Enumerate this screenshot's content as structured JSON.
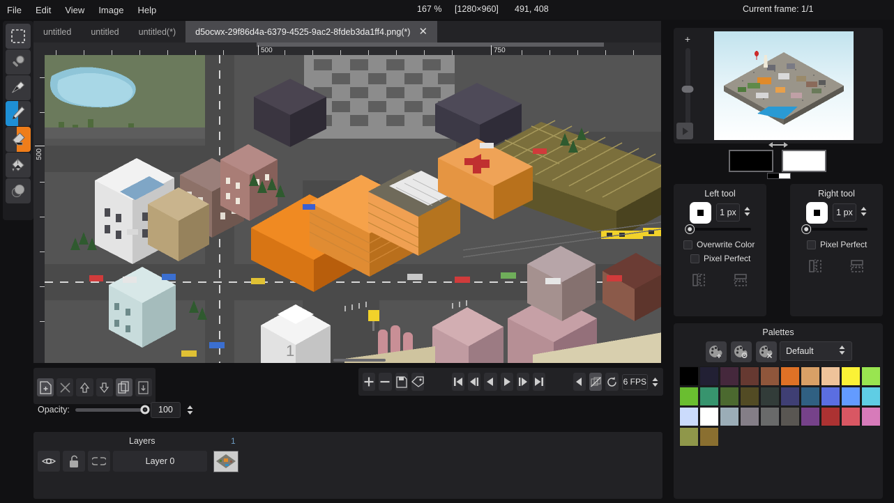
{
  "menubar": {
    "items": [
      {
        "label": "File"
      },
      {
        "label": "Edit"
      },
      {
        "label": "View"
      },
      {
        "label": "Image"
      },
      {
        "label": "Help"
      }
    ],
    "zoom": "167 %",
    "image_size": "[1280×960]",
    "cursor_coords": "491, 408",
    "current_frame": "Current frame: 1/1"
  },
  "toolbar": {
    "tools": [
      {
        "name": "rectangle-select",
        "icon": "marquee-icon",
        "selected": false
      },
      {
        "name": "zoom",
        "icon": "magnifier-icon",
        "selected": false
      },
      {
        "name": "color-picker",
        "icon": "eyedropper-icon",
        "selected": false
      },
      {
        "name": "pencil",
        "icon": "pencil-icon",
        "selected": true,
        "assigned": "left"
      },
      {
        "name": "eraser",
        "icon": "eraser-icon",
        "selected": true,
        "assigned": "right"
      },
      {
        "name": "bucket-fill",
        "icon": "bucket-icon",
        "selected": false
      },
      {
        "name": "shading",
        "icon": "shading-icon",
        "selected": false
      }
    ]
  },
  "tabs": [
    {
      "label": "untitled",
      "active": false
    },
    {
      "label": "untitled",
      "active": false
    },
    {
      "label": "untitled(*)",
      "active": false
    },
    {
      "label": "d5ocwx-29f86d4a-6379-4525-9ac2-8fdeb3da1ff4.png(*)",
      "active": true,
      "close": "✕"
    }
  ],
  "canvas": {
    "ruler_h_labels": [
      "500",
      "750"
    ],
    "ruler_v_labels": [
      "500"
    ]
  },
  "layer_tools": {
    "buttons": [
      {
        "name": "add-layer",
        "icon": "page-plus-icon",
        "active": true
      },
      {
        "name": "delete-layer",
        "icon": "page-x-icon",
        "active": false
      },
      {
        "name": "move-layer-up",
        "icon": "arrow-up-icon",
        "active": false
      },
      {
        "name": "move-layer-down",
        "icon": "arrow-down-icon",
        "active": false
      },
      {
        "name": "duplicate-layer",
        "icon": "copy-pages-icon",
        "active": true
      },
      {
        "name": "merge-layer-down",
        "icon": "page-merge-down-icon",
        "active": false
      }
    ],
    "opacity_label": "Opacity:",
    "opacity_value": "100"
  },
  "anim_tools": {
    "buttons": [
      {
        "name": "add-frame",
        "icon": "plus-icon"
      },
      {
        "name": "remove-frame",
        "icon": "minus-icon"
      },
      {
        "name": "duplicate-frame",
        "icon": "save-frame-icon"
      },
      {
        "name": "frame-tag",
        "icon": "tag-icon"
      },
      {
        "name": "go-first-frame",
        "icon": "skip-back-icon"
      },
      {
        "name": "step-back-frame",
        "icon": "prev-frame-icon"
      },
      {
        "name": "play-reverse",
        "icon": "play-back-icon"
      },
      {
        "name": "play",
        "icon": "play-icon"
      },
      {
        "name": "step-forward-frame",
        "icon": "next-frame-icon"
      },
      {
        "name": "go-last-frame",
        "icon": "skip-forward-icon"
      },
      {
        "name": "onion-skin-prev",
        "icon": "onion-prev-icon"
      },
      {
        "name": "onion-skin-toggle",
        "icon": "onion-off-icon"
      },
      {
        "name": "loop-playback",
        "icon": "loop-icon"
      }
    ],
    "fps": "6 FPS"
  },
  "layers_panel": {
    "title": "Layers",
    "frame_number": "1",
    "row_buttons": [
      {
        "name": "toggle-visibility",
        "icon": "eye-icon"
      },
      {
        "name": "toggle-lock",
        "icon": "unlock-icon"
      },
      {
        "name": "toggle-link",
        "icon": "link-icon"
      }
    ],
    "layers": [
      {
        "name": "Layer 0"
      }
    ]
  },
  "preview_panel": {
    "zoom_plus": "+",
    "zoom_minus": "-",
    "play_icon": "play-icon"
  },
  "colors": {
    "primary": "#000000",
    "secondary": "#ffffff",
    "swap_icon": "swap-arrows-icon"
  },
  "left_tool": {
    "title": "Left tool",
    "size": "1 px",
    "options": [
      {
        "label": "Overwrite Color",
        "checked": false
      },
      {
        "label": "Pixel Perfect",
        "checked": false
      }
    ],
    "mirror_buttons": [
      {
        "name": "mirror-horizontal",
        "icon": "mirror-h-icon"
      },
      {
        "name": "mirror-vertical",
        "icon": "mirror-v-icon"
      }
    ]
  },
  "right_tool": {
    "title": "Right tool",
    "size": "1 px",
    "options": [
      {
        "label": "Pixel Perfect",
        "checked": false
      }
    ],
    "mirror_buttons": [
      {
        "name": "mirror-horizontal",
        "icon": "mirror-h-icon"
      },
      {
        "name": "mirror-vertical",
        "icon": "mirror-v-icon"
      }
    ]
  },
  "palettes": {
    "title": "Palettes",
    "buttons": [
      {
        "name": "add-palette",
        "icon": "palette-plus-icon"
      },
      {
        "name": "edit-palette",
        "icon": "palette-gear-icon"
      },
      {
        "name": "delete-palette",
        "icon": "palette-x-icon"
      }
    ],
    "selected": "Default",
    "swatches": [
      "#000000",
      "#222034",
      "#45283c",
      "#663931",
      "#8f563b",
      "#df7126",
      "#d9a066",
      "#eec39a",
      "#fbf236",
      "#99e550",
      "#6abe30",
      "#37946e",
      "#4b692f",
      "#524b24",
      "#323c39",
      "#3f3f74",
      "#306082",
      "#5b6ee1",
      "#639bff",
      "#5fcde4",
      "#cbdbfc",
      "#ffffff",
      "#9badb7",
      "#847e87",
      "#696a6a",
      "#595652",
      "#76428a",
      "#ac3232",
      "#d95763",
      "#d77bba",
      "#8f974a",
      "#8a6f30"
    ]
  }
}
